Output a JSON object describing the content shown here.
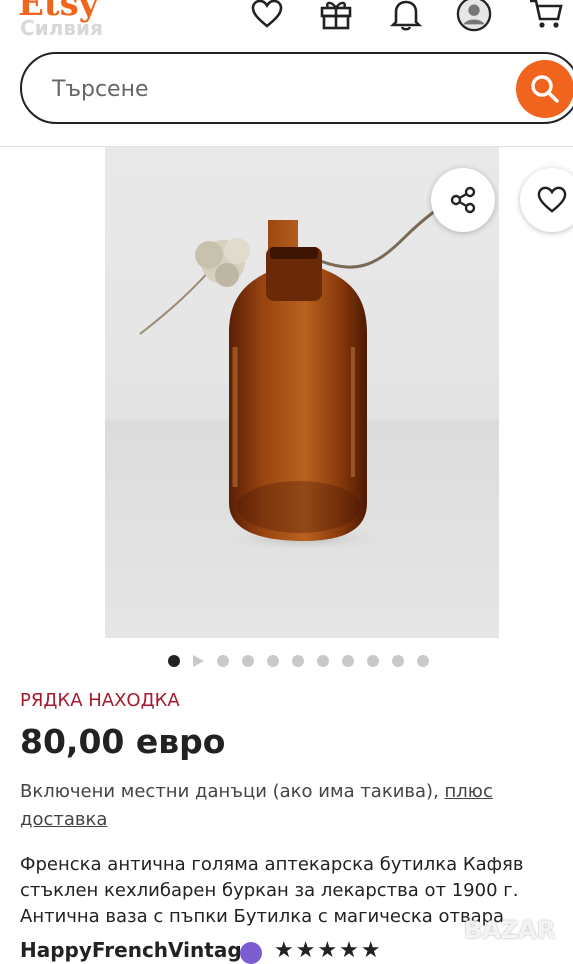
{
  "header": {
    "logo": "Etsy",
    "sublogo": "Силвия",
    "icons": [
      "heart-icon",
      "gift-icon",
      "bell-icon",
      "avatar-icon",
      "cart-icon"
    ]
  },
  "search": {
    "placeholder": "Търсене",
    "value": ""
  },
  "gallery": {
    "dot_count": 11,
    "active_index": 0,
    "share_icon": "share-icon",
    "favorite_icon": "heart-icon"
  },
  "listing": {
    "badge": "РЯДКА НАХОДКА",
    "price": "80,00 евро",
    "tax_text": "Включени местни данъци (ако има такива),",
    "shipping_link": "плюс доставка",
    "title": "Френска антична голяма аптекарска бутилка Кафяв стъклен кехлибарен буркан за лекарства от 1900 г. Антична ваза с пъпки Бутилка с магическа отвара",
    "shop_name": "HappyFrenchVintage",
    "rating": "★★★★★"
  },
  "watermark": "BAZAR",
  "colors": {
    "accent": "#f1641e",
    "badge": "#a61a2e",
    "bottle": "#8a3a0c"
  }
}
